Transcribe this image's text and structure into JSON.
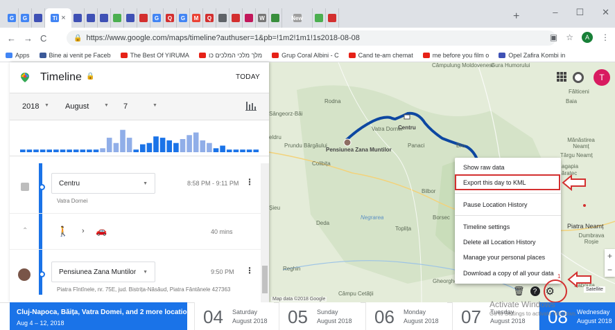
{
  "browser": {
    "tabs": [
      {
        "letter": "G",
        "color": "#4285f4"
      },
      {
        "letter": "G",
        "color": "#4285f4"
      },
      {
        "letter": "",
        "color": "#3f51b5"
      },
      {
        "letter": "Ti",
        "color": "#4285f4",
        "active": true
      },
      {
        "letter": "",
        "color": "#3f51b5"
      },
      {
        "letter": "",
        "color": "#3f51b5"
      },
      {
        "letter": "",
        "color": "#3f51b5"
      },
      {
        "letter": "",
        "color": "#4caf50"
      },
      {
        "letter": "",
        "color": "#3f51b5"
      },
      {
        "letter": "",
        "color": "#d32f2f"
      },
      {
        "letter": "G",
        "color": "#4285f4"
      },
      {
        "letter": "Q",
        "color": "#d32f2f"
      },
      {
        "letter": "G",
        "color": "#4285f4"
      },
      {
        "letter": "M",
        "color": "#ea4335"
      },
      {
        "letter": "Q",
        "color": "#d32f2f"
      },
      {
        "letter": "",
        "color": "#5f6368"
      },
      {
        "letter": "",
        "color": "#d32f2f"
      },
      {
        "letter": "",
        "color": "#c2185b"
      },
      {
        "letter": "W",
        "color": "#777777"
      },
      {
        "letter": "",
        "color": "#388e3c"
      },
      {
        "letter": "New",
        "color": "#9e9e9e",
        "wide": true
      },
      {
        "letter": "",
        "color": "#4caf50"
      },
      {
        "letter": "",
        "color": "#d32f2f"
      }
    ],
    "active_tab_label": "Ti",
    "close_glyph": "×",
    "new_tab": "+",
    "window_controls": [
      "–",
      "☐",
      "✕"
    ],
    "url": "https://www.google.com/maps/timeline?authuser=1&pb=!1m2!1m1!1s2018-08-08",
    "bookmarks": [
      {
        "label": "Apps",
        "color": "#4285f4"
      },
      {
        "label": "Bine ai venit pe Faceb",
        "color": "#3b5998"
      },
      {
        "label": "The Best Of YIRUMA",
        "color": "#e62117"
      },
      {
        "label": "מלך מלכי המלכים כו",
        "color": "#e62117"
      },
      {
        "label": "Grup Coral Albini - C",
        "color": "#e62117"
      },
      {
        "label": "Cand te-am chemat",
        "color": "#e62117"
      },
      {
        "label": "me before you film o",
        "color": "#e62117"
      },
      {
        "label": "Opel Zafira Kombi in",
        "color": "#3f51b5"
      }
    ],
    "profile_initial": "A"
  },
  "timeline": {
    "title": "Timeline",
    "today_button": "TODAY",
    "year": "2018",
    "month": "August",
    "day": "7",
    "histogram_levels": [
      0.1,
      0.1,
      0.1,
      0.1,
      0.1,
      0.1,
      0.1,
      0.1,
      0.1,
      0.1,
      0.1,
      0.1,
      0.15,
      0.55,
      0.35,
      0.85,
      0.55,
      0.1,
      0.3,
      0.35,
      0.6,
      0.55,
      0.45,
      0.35,
      0.5,
      0.65,
      0.75,
      0.45,
      0.35,
      0.15,
      0.25,
      0.1,
      0.1,
      0.1,
      0.1,
      0.1
    ],
    "segments": [
      {
        "place": "Centru",
        "time": "8:58 PM - 9:11 PM",
        "address": "Vatra Dornei"
      },
      {
        "duration": "40 mins"
      },
      {
        "place": "Pensiunea Zana Muntilor",
        "time": "9:50 PM",
        "address": "Piatra Fîntînele, nr. 75E, jud. Bistrița-Năsăud, Piatra Fântânele 427363"
      }
    ]
  },
  "map": {
    "labels": {
      "campulung": "Câmpulung Moldovenesc",
      "gura": "Gura Humorului",
      "falticeni": "Fălticeni",
      "baia": "Baia",
      "rodna": "Rodna",
      "sangeorz": "Sângeorz-Băi",
      "vatra": "Vatra Dornei",
      "centru": "Centru",
      "ieldru": "eldru",
      "prundu": "Prundu Bârgăului",
      "pensiunea": "Pensiunea Zana Muntilor",
      "colibita": "Colibița",
      "panaci": "Panaci",
      "bro": "Bro",
      "manastirea": "Mănăstirea Neamț",
      "targu": "Târgu Neamț",
      "agapia": "agapia",
      "baratec": "ăratec",
      "bilbor": "Bilbor",
      "sieu": "Șieu",
      "deda": "Deda",
      "negrarea": "Negrarea",
      "toplita": "Toplița",
      "borsec": "Borsec",
      "piatra": "Piatra Neamț",
      "dumbrava": "Dumbrava Roșie",
      "reghin": "Reghin",
      "gheorghe": "Gheorghe",
      "campu": "Câmpu Cetății",
      "sabauta": "Sabouta"
    },
    "credit": "Map data ©2018 Google",
    "avatar_initial": "T",
    "satellite": "Satellite"
  },
  "settings_menu": {
    "items": [
      "Show raw data",
      "Export this day to KML",
      "Pause Location History",
      "Timeline settings",
      "Delete all Location History",
      "Manage your personal places",
      "Download a copy of all your data"
    ]
  },
  "annotation": {
    "step_number": "1",
    "highlight_color": "#d32f2f"
  },
  "activation": {
    "title": "Activate Windows",
    "subtitle": "Go to Settings to activate Windows."
  },
  "day_strip": {
    "trip_title": "Cluj-Napoca, Băița, Vatra Domei, and 2 more locations",
    "trip_dates": "Aug 4 – 12, 2018",
    "days": [
      {
        "num": "04",
        "dow": "Saturday",
        "mon": "August 2018"
      },
      {
        "num": "05",
        "dow": "Sunday",
        "mon": "August 2018"
      },
      {
        "num": "06",
        "dow": "Monday",
        "mon": "August 2018"
      },
      {
        "num": "07",
        "dow": "Tuesday",
        "mon": "August 2018"
      },
      {
        "num": "08",
        "dow": "Wednesday",
        "mon": "August 2018",
        "selected": true
      }
    ]
  }
}
